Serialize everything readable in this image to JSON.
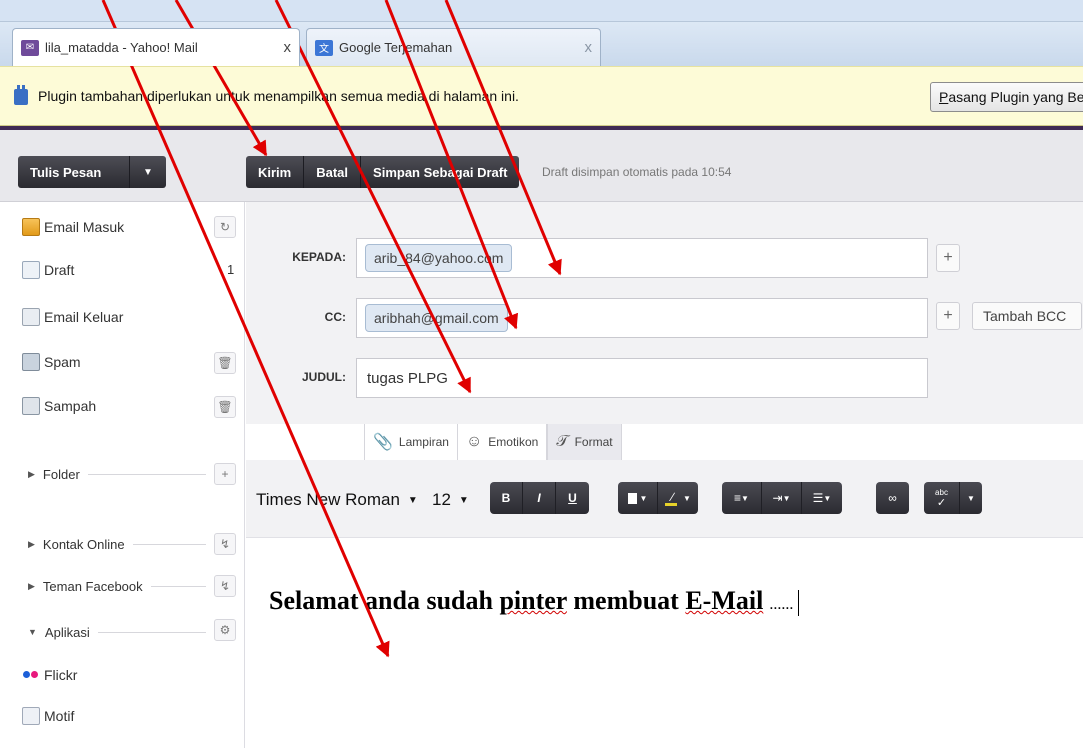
{
  "browser": {
    "tabs": [
      {
        "title": "lila_matadda - Yahoo! Mail",
        "close": "x"
      },
      {
        "title": "Google Terjemahan",
        "close": "x"
      }
    ]
  },
  "plugin_bar": {
    "message": "Plugin tambahan diperlukan untuk menampilkan semua media di halaman ini.",
    "button_underlined": "P",
    "button_rest": "asang Plugin yang Be"
  },
  "toolbar": {
    "compose_label": "Tulis Pesan",
    "compose_arrow": "▼",
    "send_label": "Kirim",
    "cancel_label": "Batal",
    "save_draft_label": "Simpan Sebagai Draft",
    "autosave_text": "Draft disimpan otomatis pada 10:54"
  },
  "sidebar": {
    "items": [
      {
        "label": "Email Masuk",
        "icon": "inbox-icon",
        "action": "↻"
      },
      {
        "label": "Draft",
        "icon": "draft-icon",
        "count": "1"
      },
      {
        "label": "Email Keluar",
        "icon": "sent-icon"
      },
      {
        "label": "Spam",
        "icon": "spam-icon",
        "action": "🗑"
      },
      {
        "label": "Sampah",
        "icon": "trash-icon",
        "action": "🗑"
      }
    ],
    "sections": [
      {
        "label": "Folder",
        "state": "collapsed",
        "action": "+"
      },
      {
        "label": "Kontak Online",
        "state": "collapsed",
        "action": "↯"
      },
      {
        "label": "Teman Facebook",
        "state": "collapsed",
        "action": "↯"
      },
      {
        "label": "Aplikasi",
        "state": "expanded",
        "action": "⚙"
      }
    ],
    "apps": [
      {
        "label": "Flickr",
        "icon": "flickr-icon"
      },
      {
        "label": "Motif",
        "icon": "motif-icon"
      }
    ]
  },
  "compose": {
    "to_label": "KEPADA:",
    "to_value": "arib_84@yahoo.com",
    "cc_label": "CC:",
    "cc_value": "aribhah@gmail.com",
    "subject_label": "JUDUL:",
    "subject_value": "tugas PLPG",
    "add_bcc_label": "Tambah BCC",
    "plus": "+",
    "attach_tabs": [
      {
        "label": "Lampiran",
        "glyph": "📎"
      },
      {
        "label": "Emotikon",
        "glyph": "☺"
      },
      {
        "label": "Format",
        "glyph": "𝒯"
      }
    ],
    "font_family": "Times New Roman",
    "font_size": "12",
    "format_buttons": {
      "bold": "B",
      "italic": "I",
      "underline": "U"
    },
    "body": {
      "part1": "Selamat anda sudah ",
      "part2_misspelled": "pinter",
      "part3": " membuat ",
      "part4_misspelled": "E-Mail",
      "part5": " ",
      "dots": "......"
    }
  },
  "colors": {
    "brand_purple": "#3f2a55",
    "arrow_red": "#e00000",
    "plugin_bar_bg": "#fdfbd7",
    "chip_bg": "#dfe8f3"
  }
}
